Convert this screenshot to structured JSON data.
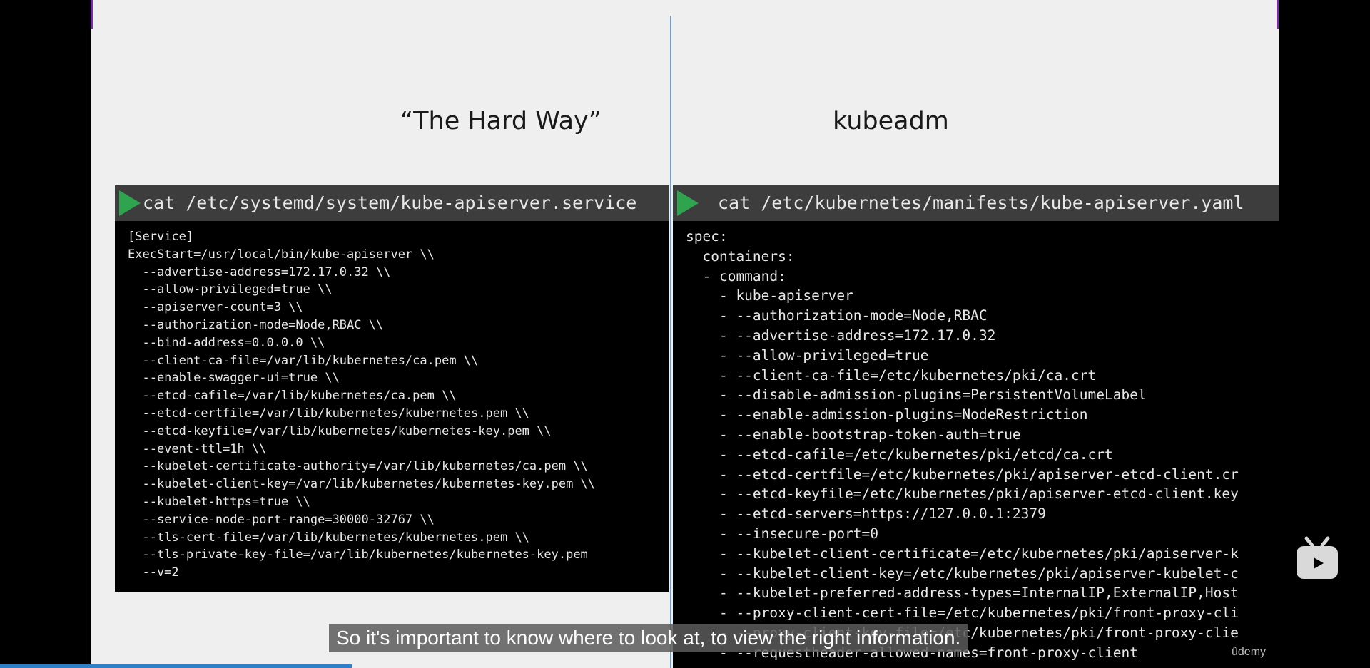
{
  "headings": {
    "left": "“The Hard Way”",
    "right": "kubeadm"
  },
  "left_terminal": {
    "command": "cat /etc/systemd/system/kube-apiserver.service",
    "lines": [
      "[Service]",
      "ExecStart=/usr/local/bin/kube-apiserver \\\\",
      "  --advertise-address=172.17.0.32 \\\\",
      "  --allow-privileged=true \\\\",
      "  --apiserver-count=3 \\\\",
      "  --authorization-mode=Node,RBAC \\\\",
      "  --bind-address=0.0.0.0 \\\\",
      "  --client-ca-file=/var/lib/kubernetes/ca.pem \\\\",
      "  --enable-swagger-ui=true \\\\",
      "  --etcd-cafile=/var/lib/kubernetes/ca.pem \\\\",
      "  --etcd-certfile=/var/lib/kubernetes/kubernetes.pem \\\\",
      "  --etcd-keyfile=/var/lib/kubernetes/kubernetes-key.pem \\\\",
      "  --event-ttl=1h \\\\",
      "  --kubelet-certificate-authority=/var/lib/kubernetes/ca.pem \\\\",
      "  --kubelet-client-key=/var/lib/kubernetes/kubernetes-key.pem \\\\",
      "  --kubelet-https=true \\\\",
      "  --service-node-port-range=30000-32767 \\\\",
      "  --tls-cert-file=/var/lib/kubernetes/kubernetes.pem \\\\",
      "  --tls-private-key-file=/var/lib/kubernetes/kubernetes-key.pem",
      "  --v=2"
    ]
  },
  "right_terminal": {
    "command": "cat /etc/kubernetes/manifests/kube-apiserver.yaml",
    "lines": [
      "spec:",
      "  containers:",
      "  - command:",
      "    - kube-apiserver",
      "    - --authorization-mode=Node,RBAC",
      "    - --advertise-address=172.17.0.32",
      "    - --allow-privileged=true",
      "    - --client-ca-file=/etc/kubernetes/pki/ca.crt",
      "    - --disable-admission-plugins=PersistentVolumeLabel",
      "    - --enable-admission-plugins=NodeRestriction",
      "    - --enable-bootstrap-token-auth=true",
      "    - --etcd-cafile=/etc/kubernetes/pki/etcd/ca.crt",
      "    - --etcd-certfile=/etc/kubernetes/pki/apiserver-etcd-client.cr",
      "    - --etcd-keyfile=/etc/kubernetes/pki/apiserver-etcd-client.key",
      "    - --etcd-servers=https://127.0.0.1:2379",
      "    - --insecure-port=0",
      "    - --kubelet-client-certificate=/etc/kubernetes/pki/apiserver-k",
      "    - --kubelet-client-key=/etc/kubernetes/pki/apiserver-kubelet-c",
      "    - --kubelet-preferred-address-types=InternalIP,ExternalIP,Host",
      "    - --proxy-client-cert-file=/etc/kubernetes/pki/front-proxy-cli",
      "    - --proxy-client-key-file=/etc/kubernetes/pki/front-proxy-clie",
      "    - --requestheader-allowed-names=front-proxy-client"
    ]
  },
  "subtitle": "So it's important to know where to look at, to view the right information.",
  "watermark": "ûdemy",
  "video_progress_percent": 25.7,
  "icons": {
    "play": "play-triangle-icon",
    "player_logo": "tv-icon"
  },
  "colors": {
    "accent": "#2ea44f",
    "frame_edge": "#7b2ca8",
    "divider": "#6f9fc6",
    "progress": "#2f7fc8"
  }
}
